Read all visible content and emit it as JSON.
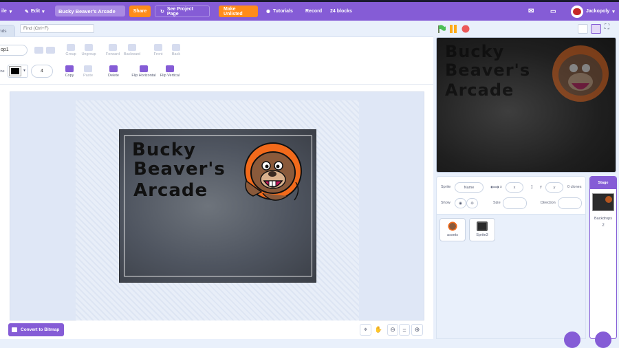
{
  "menubar": {
    "file_label": "ile",
    "edit_label": "Edit",
    "project_title": "Bucky Beaver's Arcade",
    "share_label": "Share",
    "see_project_label": "See Project Page",
    "make_unlisted_label": "Make Unlisted",
    "tutorials_label": "Tutorials",
    "record_label": "Record",
    "blocks_count": "24 blocks",
    "username": "Jackopoly",
    "accent_color": "#855cd6",
    "orange_color": "#ff8c1a"
  },
  "editor": {
    "costumes_tab_label": "nds",
    "find_placeholder": "Find (Ctrl+F)",
    "costume_name": "op1",
    "outline_label": "line",
    "outline_width": "4",
    "tools": {
      "group": "Group",
      "ungroup": "Ungroup",
      "forward": "Forward",
      "backward": "Backward",
      "front": "Front",
      "back": "Back",
      "copy": "Copy",
      "paste": "Paste",
      "delete": "Delete",
      "flip_horizontal": "Flip Horizontal",
      "flip_vertical": "Flip Vertical"
    },
    "art_lines": [
      "Bucky",
      "Beaver's",
      "Arcade"
    ],
    "convert_label": "Convert to Bitmap",
    "zoom_reset": "="
  },
  "stage": {
    "art_lines": [
      "Bucky",
      "Beaver's",
      "Arcade"
    ]
  },
  "sprite_info": {
    "sprite_label": "Sprite",
    "name_placeholder": "Name",
    "x_label": "x",
    "x_placeholder": "x",
    "y_label": "y",
    "y_placeholder": "y",
    "clones_label": "0 clones",
    "show_label": "Show",
    "size_label": "Size",
    "direction_label": "Direction"
  },
  "sprites": [
    {
      "name": "assets",
      "icon": "beaver-thumb"
    },
    {
      "name": "Sprite3",
      "icon": "stage-thumb"
    }
  ],
  "stage_panel": {
    "header": "Stage",
    "backdrops_label": "Backdrops",
    "backdrops_count": "2"
  }
}
